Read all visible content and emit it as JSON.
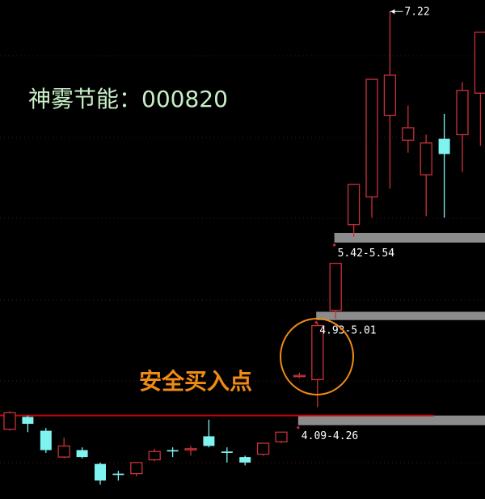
{
  "header": {
    "title": "神雾节能：000820"
  },
  "callout": {
    "label": "安全买入点"
  },
  "colors": {
    "background": "#000000",
    "up": "#c8323a",
    "down": "#7ff3f0",
    "support_line": "#d20000",
    "zone": "#8c8c8c",
    "callout": "#f08c14",
    "label": "#ffffff",
    "title": "#c8f0c8",
    "grid": "#5a0f0f"
  },
  "chart_data": {
    "type": "candlestick",
    "title": "神雾节能：000820",
    "ylim": [
      3.72,
      7.28
    ],
    "support_level": 4.3,
    "peak_label": "7.22",
    "candles": [
      {
        "o": 4.2,
        "c": 4.32,
        "h": 4.33,
        "l": 4.19
      },
      {
        "o": 4.29,
        "c": 4.24,
        "h": 4.3,
        "l": 4.18
      },
      {
        "o": 4.19,
        "c": 4.05,
        "h": 4.21,
        "l": 4.03
      },
      {
        "o": 4.0,
        "c": 4.08,
        "h": 4.14,
        "l": 3.99
      },
      {
        "o": 4.05,
        "c": 4.0,
        "h": 4.07,
        "l": 3.99
      },
      {
        "o": 3.95,
        "c": 3.83,
        "h": 3.96,
        "l": 3.8
      },
      {
        "o": 3.88,
        "c": 3.87,
        "h": 3.9,
        "l": 3.83
      },
      {
        "o": 3.88,
        "c": 3.96,
        "h": 3.96,
        "l": 3.86
      },
      {
        "o": 3.98,
        "c": 4.04,
        "h": 4.06,
        "l": 3.97
      },
      {
        "o": 4.05,
        "c": 4.04,
        "h": 4.07,
        "l": 4.0
      },
      {
        "o": 4.06,
        "c": 4.06,
        "h": 4.08,
        "l": 4.01
      },
      {
        "o": 4.15,
        "c": 4.08,
        "h": 4.27,
        "l": 4.07
      },
      {
        "o": 4.04,
        "c": 4.03,
        "h": 4.07,
        "l": 3.96
      },
      {
        "o": 4.0,
        "c": 3.96,
        "h": 4.01,
        "l": 3.94
      },
      {
        "o": 4.02,
        "c": 4.1,
        "h": 4.1,
        "l": 4.01
      },
      {
        "o": 4.11,
        "c": 4.18,
        "h": 4.18,
        "l": 4.1
      },
      {
        "o": 4.59,
        "c": 4.59,
        "h": 4.61,
        "l": 4.57
      },
      {
        "o": 4.56,
        "c": 4.95,
        "h": 4.97,
        "l": 4.36
      },
      {
        "o": 5.06,
        "c": 5.4,
        "h": 5.4,
        "l": 5.0
      },
      {
        "o": 5.68,
        "c": 5.97,
        "h": 5.97,
        "l": 5.59
      },
      {
        "o": 5.88,
        "c": 6.73,
        "h": 6.73,
        "l": 5.73
      },
      {
        "o": 6.47,
        "c": 6.76,
        "h": 7.22,
        "l": 5.94
      },
      {
        "o": 6.29,
        "c": 6.38,
        "h": 6.54,
        "l": 6.2
      },
      {
        "o": 6.04,
        "c": 6.27,
        "h": 6.33,
        "l": 5.74
      },
      {
        "o": 6.3,
        "c": 6.19,
        "h": 6.48,
        "l": 5.73
      },
      {
        "o": 6.33,
        "c": 6.65,
        "h": 6.71,
        "l": 6.06
      },
      {
        "o": 6.63,
        "c": 7.07,
        "h": 7.07,
        "l": 6.25
      }
    ],
    "zones": [
      {
        "label": "4.09-4.26",
        "low": 4.23,
        "high": 4.3
      },
      {
        "label": "4.93-5.01",
        "low": 4.99,
        "high": 5.05
      },
      {
        "label": "5.42-5.54",
        "low": 5.55,
        "high": 5.62
      }
    ]
  }
}
